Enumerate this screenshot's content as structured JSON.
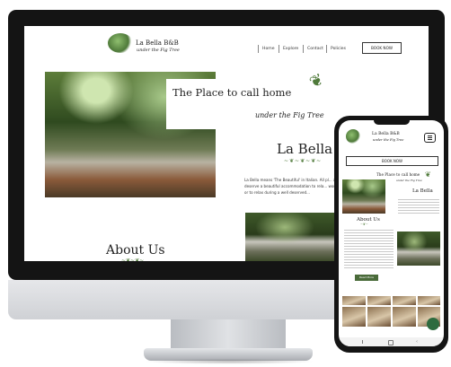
{
  "site": {
    "brand_name": "La Bella B&B",
    "brand_tagline": "under the Fig Tree",
    "nav": [
      "Home",
      "Explore",
      "Contact",
      "Policies"
    ],
    "book_button": "BOOK NOW"
  },
  "hero": {
    "heading": "The Place to call home",
    "subheading": "under the Fig Tree"
  },
  "intro": {
    "title": "La Bella",
    "text": "La Bella means 'The Beautiful' in Italian. All pl... and deserve a beautiful accommodation to rela... working day or to relax during a well deserved..."
  },
  "about": {
    "title": "About Us"
  },
  "mobile": {
    "brand_name": "La Bella B&B",
    "brand_tagline": "under the Fig Tree",
    "menu_icon": "menu-icon",
    "book_button": "BOOK NOW",
    "hero_heading": "The Place to call home",
    "hero_subheading": "under the Fig Tree",
    "la_bella_title": "La Bella",
    "about_title": "About Us",
    "read_more": "Read More",
    "chat_icon": "chat-icon"
  },
  "colors": {
    "leaf_green": "#4f7a3a",
    "button_green": "#4a6b3a",
    "chat_green": "#2e6b3f"
  }
}
